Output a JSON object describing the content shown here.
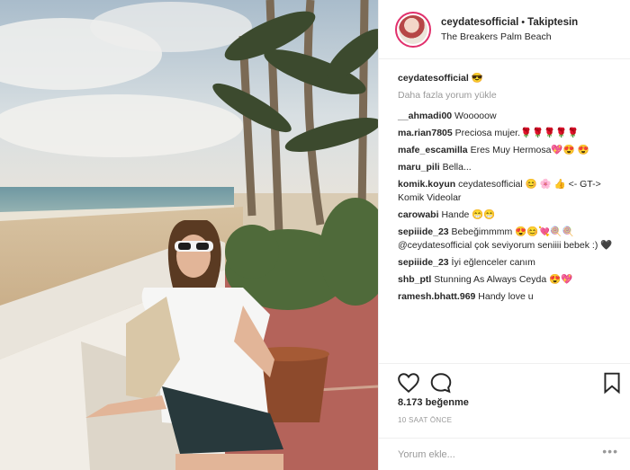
{
  "header": {
    "username": "ceydatesofficial",
    "separator": "•",
    "follow_status": "Takiptesin",
    "location": "The Breakers Palm Beach"
  },
  "caption": {
    "username": "ceydatesofficial",
    "text": "😎"
  },
  "load_more": "Daha fazla yorum yükle",
  "comments": [
    {
      "user": "__ahmadi00",
      "text": "Wooooow"
    },
    {
      "user": "ma.rian7805",
      "text": "Preciosa mujer.🌹🌹🌹🌹🌹"
    },
    {
      "user": "mafe_escamilla",
      "text": "Eres Muy Hermosa💖😍 😍"
    },
    {
      "user": "maru_pili",
      "text": "Bella..."
    },
    {
      "user": "komik.koyun",
      "text": "ceydatesofficial 😊 🌸 👍 <- GT-> Komik Videolar"
    },
    {
      "user": "carowabi",
      "text": "Hande 😁😁"
    },
    {
      "user": "sepiiide_23",
      "text": "Bebeğimmmm 😍😊💘🍭🍭 @ceydatesofficial çok seviyorum seniiii bebek :) 🖤"
    },
    {
      "user": "sepiiide_23",
      "text": "İyi eğlenceler canım"
    },
    {
      "user": "shb_ptl",
      "text": "Stunning As Always Ceyda 😍💖"
    },
    {
      "user": "ramesh.bhatt.969",
      "text": "Handy love u"
    }
  ],
  "actions": {
    "likes": "8.173 beğenme",
    "time": "10 SAAT ÖNCE",
    "icons": [
      "heart-icon",
      "comment-icon",
      "bookmark-icon"
    ]
  },
  "add_comment": {
    "placeholder": "Yorum ekle...",
    "options": "•••"
  },
  "colors": {
    "link": "#003569",
    "muted": "#999999",
    "border": "#efefef",
    "avatar_ring": "#e1306c"
  }
}
